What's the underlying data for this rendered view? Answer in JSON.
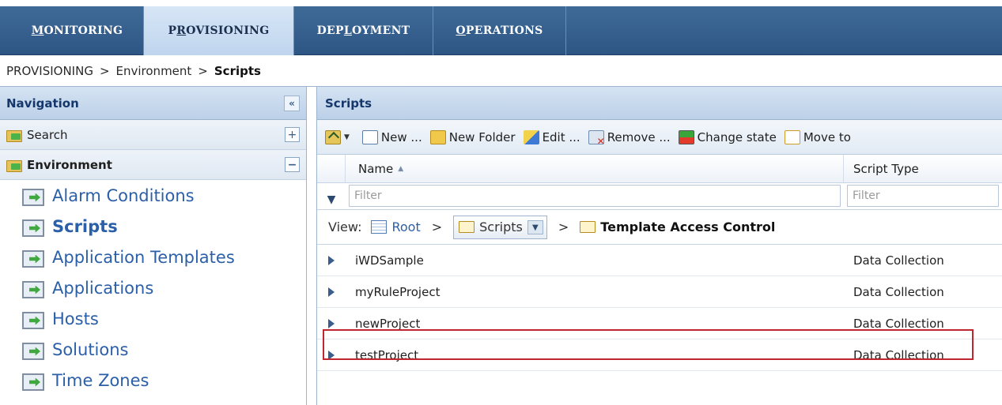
{
  "top_tabs": [
    {
      "label_u": "M",
      "label_rest": "ONITORING"
    },
    {
      "label_pre": "P",
      "label_u": "R",
      "label_rest": "OVISIONING"
    },
    {
      "label_pre": "DEP",
      "label_u": "L",
      "label_rest": "OYMENT"
    },
    {
      "label_u": "O",
      "label_rest": "PERATIONS"
    }
  ],
  "breadcrumb": {
    "items": [
      "PROVISIONING",
      "Environment"
    ],
    "separator": ">",
    "current": "Scripts"
  },
  "navigation": {
    "title": "Navigation",
    "collapse_glyph": "«",
    "groups": [
      {
        "label": "Search",
        "toggle": "+"
      },
      {
        "label": "Environment",
        "toggle": "−"
      }
    ],
    "items": [
      {
        "label": "Alarm Conditions"
      },
      {
        "label": "Scripts"
      },
      {
        "label": "Application Templates"
      },
      {
        "label": "Applications"
      },
      {
        "label": "Hosts"
      },
      {
        "label": "Solutions"
      },
      {
        "label": "Time Zones"
      }
    ],
    "active_item": "Scripts"
  },
  "scripts_panel": {
    "title": "Scripts",
    "toolbar": {
      "new": "New ...",
      "new_folder": "New Folder",
      "edit": "Edit ...",
      "remove": "Remove ...",
      "change_state": "Change state",
      "move_to": "Move to"
    },
    "columns": {
      "name": "Name",
      "script_type": "Script Type"
    },
    "filter_placeholder": "Filter",
    "view": {
      "label": "View:",
      "root": "Root",
      "separator": ">",
      "folder": "Scripts",
      "subfolder": "Template Access Control"
    },
    "rows": [
      {
        "name": "iWDSample",
        "type": "Data Collection"
      },
      {
        "name": "myRuleProject",
        "type": "Data Collection"
      },
      {
        "name": "newProject",
        "type": "Data Collection"
      },
      {
        "name": "testProject",
        "type": "Data Collection"
      }
    ],
    "highlighted_row": "newProject"
  },
  "colors": {
    "tab_bar": "#2e5684",
    "active_tab": "#c6daf0",
    "link": "#2b5fa8",
    "highlight_border": "#c0262d"
  }
}
